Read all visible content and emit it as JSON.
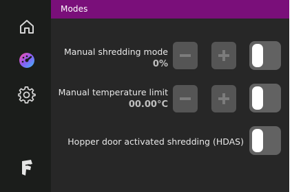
{
  "header": {
    "title": "Modes"
  },
  "nav": [
    {
      "name": "home",
      "icon": "home-icon",
      "active": false
    },
    {
      "name": "dashboard",
      "icon": "dashboard-gauge-icon",
      "active": true
    },
    {
      "name": "settings",
      "icon": "gear-icon",
      "active": false
    },
    {
      "name": "brand",
      "icon": "brand-logo-icon",
      "active": false
    }
  ],
  "controls": {
    "manual_shredding": {
      "label": "Manual shredding mode",
      "value": "0%",
      "decrement_icon": "minus-icon",
      "increment_icon": "plus-icon",
      "enabled": false
    },
    "manual_temperature": {
      "label": "Manual temperature limit",
      "value": "00.00°C",
      "decrement_icon": "minus-icon",
      "increment_icon": "plus-icon",
      "enabled": false
    },
    "hdas": {
      "label": "Hopper door activated shredding (HDAS)",
      "enabled": false
    }
  },
  "colors": {
    "header": "#7a0f7a",
    "background": "#272727",
    "sidebar": "#1b1d1b",
    "button": "#555555",
    "toggle_track": "#626262"
  }
}
